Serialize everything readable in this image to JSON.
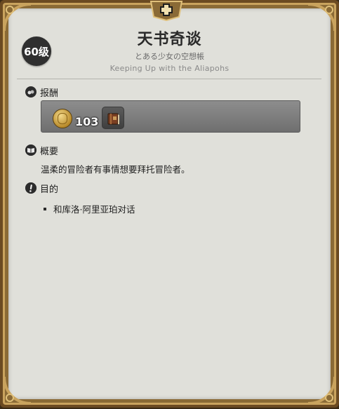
{
  "quest": {
    "level": "60级",
    "title": "天书奇谈",
    "subtitle_jp": "とある少女の空想帳",
    "subtitle_en": "Keeping Up with the Aliapohs"
  },
  "sections": {
    "reward": {
      "label": "报酬",
      "icon": "coin-bag-icon",
      "gil": "103",
      "items": [
        {
          "icon": "book-item-icon"
        }
      ]
    },
    "summary": {
      "label": "概要",
      "icon": "book-icon",
      "text": "温柔的冒险者有事情想要拜托冒险者。"
    },
    "objective": {
      "label": "目的",
      "icon": "exclamation-icon",
      "items": [
        "和库洛·阿里亚珀对话"
      ]
    }
  },
  "colors": {
    "frame": "#6b4a22",
    "frame_trim": "#c9a35e",
    "panel_bg": "#e0e0da",
    "badge_bg": "#2f2f2f",
    "reward_bg": "#7d7d7d"
  }
}
